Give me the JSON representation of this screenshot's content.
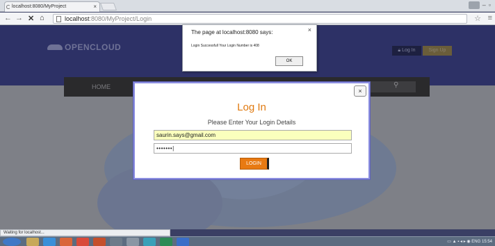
{
  "browser": {
    "tab_title": "localhost:8080/MyProject",
    "tab_close": "×",
    "url_host": "localhost",
    "url_path": ":8080/MyProject/Login",
    "back": "←",
    "forward": "→",
    "stop": "✕",
    "home": "⌂",
    "star": "☆",
    "menu": "≡",
    "status_text": "Waiting for localhost..."
  },
  "site": {
    "logo_text": "OPENCLOUD",
    "login_label": "Log In",
    "signup_label": "Sign Up",
    "nav_home": "HOME",
    "search_icon": "search-icon"
  },
  "login_modal": {
    "title": "Log In",
    "subtitle": "Please Enter Your Login Details",
    "email_value": "saurin.says@gmail.com",
    "password_value": "•••••••|",
    "submit_label": "LOGIN",
    "close_label": "×"
  },
  "alert": {
    "title": "The page at localhost:8080 says:",
    "close": "×",
    "message": "Login Successfull Your Login Number is 408",
    "ok_label": "OK"
  },
  "taskbar": {
    "lang": "ENG",
    "time": "15:54"
  },
  "colors": {
    "accent_orange": "#e87a12",
    "header_navy": "#2d3166",
    "modal_border": "#8b8ee0"
  }
}
